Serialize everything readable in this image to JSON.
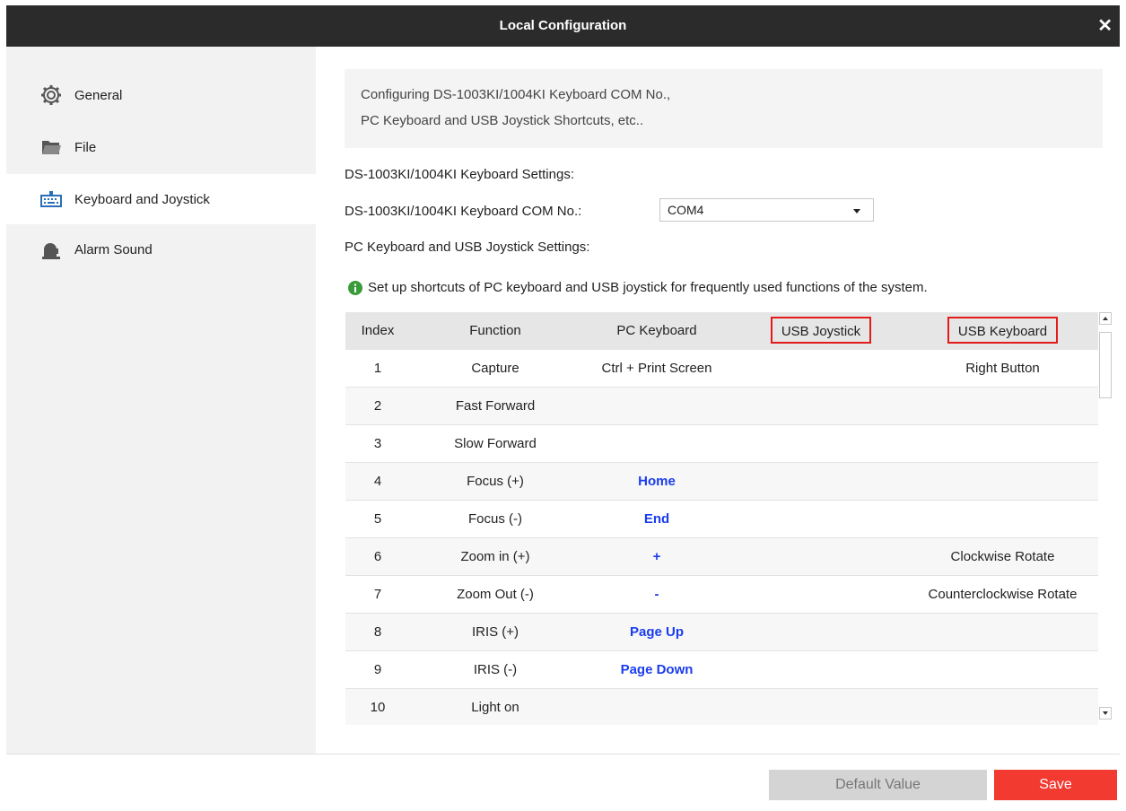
{
  "window": {
    "title": "Local Configuration",
    "close_glyph": "✕"
  },
  "sidebar": {
    "items": [
      {
        "label": "General",
        "icon": "gear-icon",
        "active": false
      },
      {
        "label": "File",
        "icon": "folder-icon",
        "active": false
      },
      {
        "label": "Keyboard and Joystick",
        "icon": "keyboard-icon",
        "active": true
      },
      {
        "label": "Alarm Sound",
        "icon": "alarm-sound-icon",
        "active": false
      }
    ]
  },
  "main": {
    "description": {
      "line1": "Configuring DS-1003KI/1004KI Keyboard COM No.,",
      "line2": "PC Keyboard and USB Joystick Shortcuts, etc.."
    },
    "keyboard_settings_heading": "DS-1003KI/1004KI Keyboard Settings:",
    "com_label": "DS-1003KI/1004KI Keyboard COM No.:",
    "com_value": "COM4",
    "pc_settings_heading": "PC Keyboard and USB Joystick Settings:",
    "info_text": "Set up shortcuts of PC keyboard and USB joystick for frequently used functions of the system.",
    "table": {
      "headers": [
        "Index",
        "Function",
        "PC Keyboard",
        "USB Joystick",
        "USB Keyboard"
      ],
      "rows": [
        {
          "index": "1",
          "function": "Capture",
          "pc": "Ctrl + Print Screen",
          "joystick": "",
          "usb": "Right Button"
        },
        {
          "index": "2",
          "function": "Fast Forward",
          "pc": "",
          "joystick": "",
          "usb": ""
        },
        {
          "index": "3",
          "function": "Slow Forward",
          "pc": "",
          "joystick": "",
          "usb": ""
        },
        {
          "index": "4",
          "function": "Focus (+)",
          "pc": "Home",
          "joystick": "",
          "usb": ""
        },
        {
          "index": "5",
          "function": "Focus (-)",
          "pc": "End",
          "joystick": "",
          "usb": ""
        },
        {
          "index": "6",
          "function": "Zoom in (+)",
          "pc": "+",
          "joystick": "",
          "usb": "Clockwise Rotate"
        },
        {
          "index": "7",
          "function": "Zoom Out (-)",
          "pc": "-",
          "joystick": "",
          "usb": "Counterclockwise Rotate"
        },
        {
          "index": "8",
          "function": "IRIS (+)",
          "pc": "Page Up",
          "joystick": "",
          "usb": ""
        },
        {
          "index": "9",
          "function": "IRIS (-)",
          "pc": "Page Down",
          "joystick": "",
          "usb": ""
        },
        {
          "index": "10",
          "function": "Light on",
          "pc": "",
          "joystick": "",
          "usb": ""
        }
      ]
    }
  },
  "footer": {
    "default_label": "Default Value",
    "save_label": "Save"
  },
  "colors": {
    "title_bar": "#2b2b2b",
    "accent_red": "#f23a31",
    "highlight_box": "#e21b1b",
    "link_blue": "#1a3cf0"
  }
}
